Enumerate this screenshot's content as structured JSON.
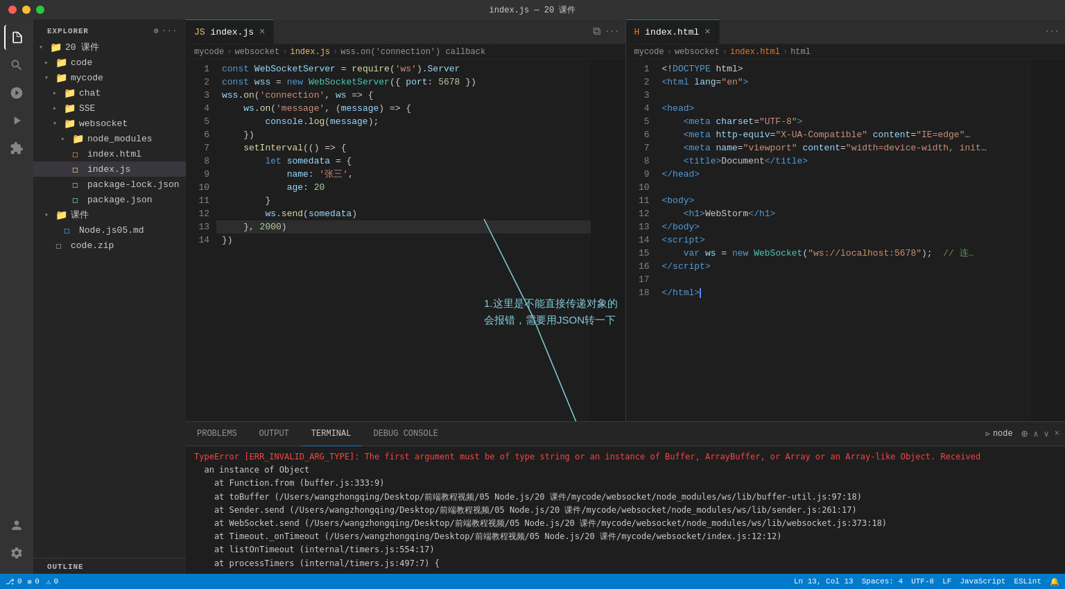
{
  "titleBar": {
    "title": "index.js — 20 课件"
  },
  "activityBar": {
    "icons": [
      {
        "name": "files-icon",
        "symbol": "⧉",
        "active": true
      },
      {
        "name": "search-icon",
        "symbol": "🔍",
        "active": false
      },
      {
        "name": "source-control-icon",
        "symbol": "⑂",
        "active": false
      },
      {
        "name": "run-icon",
        "symbol": "▶",
        "active": false
      },
      {
        "name": "extensions-icon",
        "symbol": "⊞",
        "active": false
      }
    ],
    "bottomIcons": [
      {
        "name": "account-icon",
        "symbol": "👤"
      },
      {
        "name": "settings-icon",
        "symbol": "⚙"
      }
    ]
  },
  "sidebar": {
    "title": "EXPLORER",
    "tree": [
      {
        "id": "root-20",
        "label": "20 课件",
        "indent": 0,
        "type": "folder",
        "open": true
      },
      {
        "id": "folder-code",
        "label": "code",
        "indent": 1,
        "type": "folder",
        "open": false
      },
      {
        "id": "folder-mycode",
        "label": "mycode",
        "indent": 1,
        "type": "folder",
        "open": true
      },
      {
        "id": "folder-chat",
        "label": "chat",
        "indent": 2,
        "type": "folder",
        "open": false
      },
      {
        "id": "folder-sse",
        "label": "SSE",
        "indent": 2,
        "type": "folder",
        "open": false
      },
      {
        "id": "folder-websocket",
        "label": "websocket",
        "indent": 2,
        "type": "folder",
        "open": true
      },
      {
        "id": "folder-node_modules",
        "label": "node_modules",
        "indent": 3,
        "type": "folder",
        "open": false
      },
      {
        "id": "file-index-html",
        "label": "index.html",
        "indent": 3,
        "type": "html",
        "open": false
      },
      {
        "id": "file-index-js",
        "label": "index.js",
        "indent": 3,
        "type": "js",
        "active": true
      },
      {
        "id": "file-package-lock",
        "label": "package-lock.json",
        "indent": 3,
        "type": "json"
      },
      {
        "id": "file-package",
        "label": "package.json",
        "indent": 3,
        "type": "json"
      },
      {
        "id": "folder-kejian",
        "label": "课件",
        "indent": 1,
        "type": "folder",
        "open": true
      },
      {
        "id": "file-nodejs05",
        "label": "Node.js05.md",
        "indent": 2,
        "type": "md"
      },
      {
        "id": "file-code-zip",
        "label": "code.zip",
        "indent": 1,
        "type": "zip"
      }
    ],
    "outline": "OUTLINE"
  },
  "editor1": {
    "tab": {
      "label": "index.js",
      "type": "js",
      "active": true
    },
    "breadcrumb": [
      "mycode",
      ">",
      "websocket",
      ">",
      "index.js",
      ">",
      "wss.on('connection') callback"
    ],
    "lines": [
      {
        "n": 1,
        "code": "<span class='kw'>const</span> <span class='var'>WebSocketServer</span> <span class='op'>=</span> <span class='fn'>require</span>(<span class='str'>'ws'</span>).<span class='prop'>Server</span>"
      },
      {
        "n": 2,
        "code": "<span class='kw'>const</span> <span class='var'>wss</span> <span class='op'>=</span> <span class='kw'>new</span> <span class='cn'>WebSocketServer</span>({ <span class='prop'>port</span>: <span class='num'>5678</span> })"
      },
      {
        "n": 3,
        "code": "<span class='var'>wss</span>.<span class='fn'>on</span>(<span class='str'>'connection'</span>, <span class='var'>ws</span> <span class='op'>=&gt;</span> {"
      },
      {
        "n": 4,
        "code": "    <span class='var'>ws</span>.<span class='fn'>on</span>(<span class='str'>'message'</span>, (<span class='var'>message</span>) <span class='op'>=&gt;</span> {"
      },
      {
        "n": 5,
        "code": "        <span class='fn'>console</span>.<span class='fn'>log</span>(<span class='var'>message</span>);"
      },
      {
        "n": 6,
        "code": "    })"
      },
      {
        "n": 7,
        "code": "    <span class='fn'>setInterval</span>(() <span class='op'>=&gt;</span> {"
      },
      {
        "n": 8,
        "code": "        <span class='kw'>let</span> <span class='var'>somedata</span> <span class='op'>=</span> {"
      },
      {
        "n": 9,
        "code": "            <span class='prop'>name</span>: <span class='str'>'张三'</span>,"
      },
      {
        "n": 10,
        "code": "            <span class='prop'>age</span>: <span class='num'>20</span>"
      },
      {
        "n": 11,
        "code": "        }"
      },
      {
        "n": 12,
        "code": "        <span class='var'>ws</span>.<span class='fn'>send</span>(<span class='var'>somedata</span>)"
      },
      {
        "n": 13,
        "code": "    }, <span class='num'>2000</span>)",
        "highlighted": true
      },
      {
        "n": 14,
        "code": "})"
      }
    ]
  },
  "editor2": {
    "tab": {
      "label": "index.html",
      "type": "html",
      "active": true
    },
    "breadcrumb": [
      "mycode",
      ">",
      "websocket",
      ">",
      "index.html",
      ">",
      "html"
    ],
    "lines": [
      {
        "n": 1,
        "code": "<span class='plain'>&lt;!</span><span class='kw'>DOCTYPE</span> <span class='plain'>html</span><span class='plain'>&gt;</span>"
      },
      {
        "n": 2,
        "code": "<span class='tag'>&lt;html</span> <span class='attr'>lang</span>=<span class='val'>\"en\"</span><span class='tag'>&gt;</span>"
      },
      {
        "n": 3,
        "code": ""
      },
      {
        "n": 4,
        "code": "<span class='tag'>&lt;head&gt;</span>"
      },
      {
        "n": 5,
        "code": "    <span class='tag'>&lt;meta</span> <span class='attr'>charset</span>=<span class='val'>\"UTF-8\"</span><span class='tag'>&gt;</span>"
      },
      {
        "n": 6,
        "code": "    <span class='tag'>&lt;meta</span> <span class='attr'>http-equiv</span>=<span class='val'>\"X-UA-Compatible\"</span> <span class='attr'>content</span>=<span class='val'>\"IE=edge\"</span><span class='plain'>…</span>"
      },
      {
        "n": 7,
        "code": "    <span class='tag'>&lt;meta</span> <span class='attr'>name</span>=<span class='val'>\"viewport\"</span> <span class='attr'>content</span>=<span class='val'>\"width=device-width, init</span><span class='plain'>…</span>"
      },
      {
        "n": 8,
        "code": "    <span class='tag'>&lt;title&gt;</span>Document<span class='tag'>&lt;/title&gt;</span>"
      },
      {
        "n": 9,
        "code": "<span class='tag'>&lt;/head&gt;</span>"
      },
      {
        "n": 10,
        "code": ""
      },
      {
        "n": 11,
        "code": "<span class='tag'>&lt;body&gt;</span>"
      },
      {
        "n": 12,
        "code": "    <span class='tag'>&lt;h1&gt;</span>WebStorm<span class='tag'>&lt;/h1&gt;</span>"
      },
      {
        "n": 13,
        "code": "<span class='tag'>&lt;/body&gt;</span>"
      },
      {
        "n": 14,
        "code": "<span class='tag'>&lt;script&gt;</span>"
      },
      {
        "n": 15,
        "code": "    <span class='kw'>var</span> <span class='var'>ws</span> <span class='op'>=</span> <span class='kw'>new</span> <span class='cn'>WebSocket</span>(<span class='str'>\"ws://localhost:5678\"</span>);  <span class='comment'>// 连…</span>"
      },
      {
        "n": 16,
        "code": "<span class='tag'>&lt;/script&gt;</span>"
      },
      {
        "n": 17,
        "code": ""
      },
      {
        "n": 18,
        "code": "<span class='tag'>&lt;/html&gt;</span>",
        "cursor": true
      }
    ]
  },
  "annotation": {
    "text1": "1.这里是不能直接传递对象的",
    "text2": "会报错，需要用JSON转一下"
  },
  "panel": {
    "tabs": [
      "PROBLEMS",
      "OUTPUT",
      "TERMINAL",
      "DEBUG CONSOLE"
    ],
    "activeTab": "TERMINAL",
    "terminalLabel": "node",
    "content": [
      {
        "type": "error",
        "text": "TypeError [ERR_INVALID_ARG_TYPE]: The first argument must be of type string or an instance of Buffer, ArrayBuffer, or Array or an Array-like Object. Received"
      },
      {
        "type": "normal",
        "text": "  an instance of Object"
      },
      {
        "type": "normal",
        "text": "    at Function.from (buffer.js:333:9)"
      },
      {
        "type": "normal",
        "text": "    at toBuffer (/Users/wangzhongqing/Desktop/前端教程视频/05 Node.js/20 课件/mycode/websocket/node_modules/ws/lib/buffer-util.js:97:18)"
      },
      {
        "type": "normal",
        "text": "    at Sender.send (/Users/wangzhongqing/Desktop/前端教程视频/05 Node.js/20 课件/mycode/websocket/node_modules/ws/lib/sender.js:261:17)"
      },
      {
        "type": "normal",
        "text": "    at WebSocket.send (/Users/wangzhongqing/Desktop/前端教程视频/05 Node.js/20 课件/mycode/websocket/node_modules/ws/lib/websocket.js:373:18)"
      },
      {
        "type": "normal",
        "text": "    at Timeout._onTimeout (/Users/wangzhongqing/Desktop/前端教程视频/05 Node.js/20 课件/mycode/websocket/index.js:12:12)"
      },
      {
        "type": "normal",
        "text": "    at listOnTimeout (internal/timers.js:554:17)"
      },
      {
        "type": "normal",
        "text": "    at processTimers (internal/timers.js:497:7) {"
      }
    ]
  },
  "statusBar": {
    "left": [
      {
        "name": "git-branch",
        "text": "⎇  0"
      },
      {
        "name": "errors",
        "text": "⊗ 0"
      }
    ],
    "right": [
      {
        "name": "position",
        "text": "Ln 13, Col 13"
      },
      {
        "name": "spaces",
        "text": "Spaces: 4"
      },
      {
        "name": "encoding",
        "text": "UTF-8"
      },
      {
        "name": "eol",
        "text": "LF"
      },
      {
        "name": "language",
        "text": "JavaScript"
      },
      {
        "name": "eslint",
        "text": "ESLint"
      },
      {
        "name": "feedback",
        "text": "🔔"
      }
    ]
  }
}
